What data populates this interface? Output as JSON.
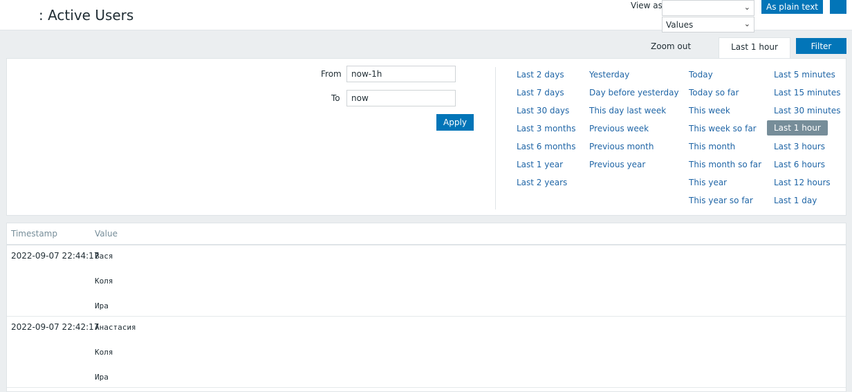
{
  "header": {
    "title": ": Active Users",
    "view_as_label": "View as",
    "view_as_value": "",
    "values_select": "Values",
    "plain_text_button": "As plain text"
  },
  "toolbar": {
    "zoom_out": "Zoom out",
    "active_tab": "Last 1 hour",
    "filter_button": "Filter"
  },
  "filter": {
    "from_label": "From",
    "from_value": "now-1h",
    "to_label": "To",
    "to_value": "now",
    "apply_button": "Apply",
    "ranges": {
      "col1": [
        "Last 2 days",
        "Last 7 days",
        "Last 30 days",
        "Last 3 months",
        "Last 6 months",
        "Last 1 year",
        "Last 2 years"
      ],
      "col2": [
        "Yesterday",
        "Day before yesterday",
        "This day last week",
        "Previous week",
        "Previous month",
        "Previous year"
      ],
      "col3": [
        "Today",
        "Today so far",
        "This week",
        "This week so far",
        "This month",
        "This month so far",
        "This year",
        "This year so far"
      ],
      "col4": [
        "Last 5 minutes",
        "Last 15 minutes",
        "Last 30 minutes",
        "Last 1 hour",
        "Last 3 hours",
        "Last 6 hours",
        "Last 12 hours",
        "Last 1 day"
      ]
    },
    "selected_range": "Last 1 hour"
  },
  "table": {
    "columns": [
      "Timestamp",
      "Value"
    ],
    "rows": [
      {
        "timestamp": "2022-09-07 22:44:17",
        "values": [
          "Вася",
          "Коля",
          "Ира"
        ]
      },
      {
        "timestamp": "2022-09-07 22:42:17",
        "values": [
          "Анастасия",
          "Коля",
          "Ира"
        ]
      }
    ]
  },
  "colors": {
    "accent": "#0275b8",
    "link": "#1f65a6",
    "selected_range_bg": "#768d99",
    "background": "#ebeef0"
  }
}
